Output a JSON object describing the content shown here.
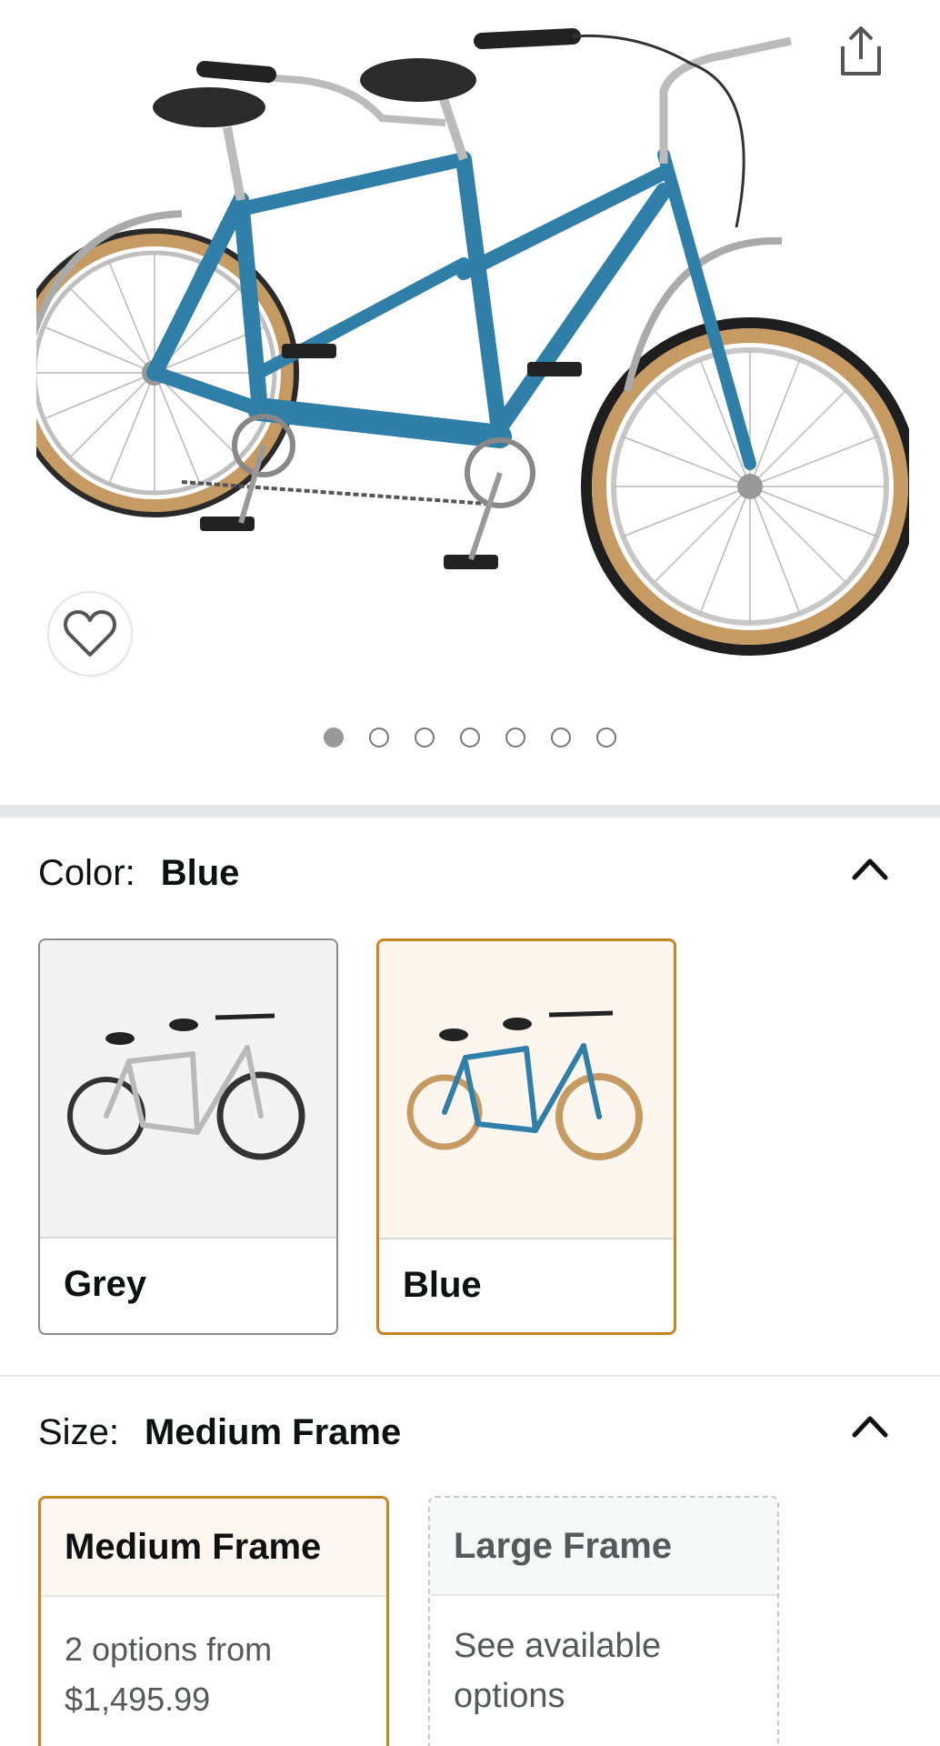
{
  "hero": {
    "image_icon": "tandem-bike-blue-image",
    "share_icon": "share-icon",
    "wishlist_icon": "heart-icon",
    "carousel_total": 7,
    "carousel_active": 1
  },
  "color": {
    "label": "Color:",
    "selected": "Blue",
    "options": [
      {
        "name": "Grey",
        "icon": "tandem-bike-grey-thumb",
        "selected": false
      },
      {
        "name": "Blue",
        "icon": "tandem-bike-blue-thumb",
        "selected": true
      }
    ]
  },
  "size": {
    "label": "Size:",
    "selected": "Medium Frame",
    "options": [
      {
        "name": "Medium Frame",
        "line1": "2 options from",
        "line2": "$1,495.99",
        "selected": true
      },
      {
        "name": "Large Frame",
        "line1": "See available",
        "line2": "options",
        "selected": false
      }
    ]
  },
  "colors": {
    "accent": "#c7841f",
    "text": "#0f1111",
    "muted": "#565959",
    "bike_blue": "#2f7fa8",
    "tire_tan": "#c69a63"
  }
}
